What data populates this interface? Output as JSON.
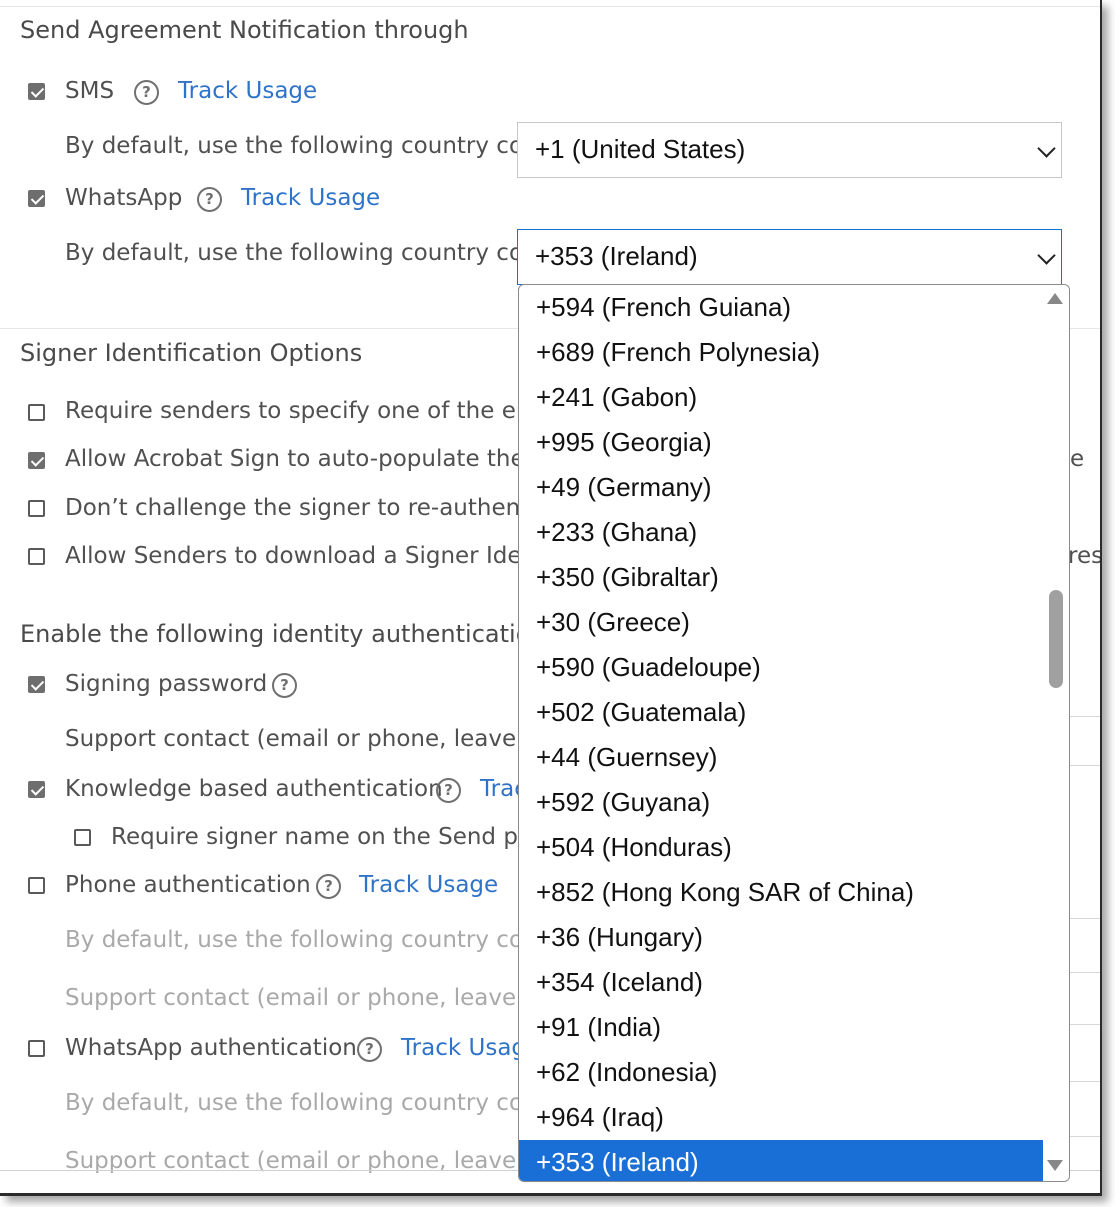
{
  "notification": {
    "heading": "Send Agreement Notification through",
    "sms_label": "SMS",
    "sms_track": "Track Usage",
    "sms_country_label": "By default, use the following country code:",
    "sms_country_value": "+1 (United States)",
    "whatsapp_label": "WhatsApp",
    "whatsapp_track": "Track Usage",
    "whatsapp_country_label": "By default, use the following country code:",
    "whatsapp_country_value": "+353 (Ireland)"
  },
  "signer": {
    "heading": "Signer Identification Options",
    "options": [
      {
        "left": "Require senders to specify one of the enab",
        "right": ""
      },
      {
        "left": "Allow Acrobat Sign to auto-populate the Si",
        "right": "e"
      },
      {
        "left": "Don’t challenge the signer to re-authenticat",
        "right": ""
      },
      {
        "left": "Allow Senders to download a Signer Identi",
        "right": "res"
      }
    ]
  },
  "auth": {
    "heading": "Enable the following identity authentication n",
    "signing_password": "Signing password",
    "support_contact": "Support contact (email or phone, leave it b",
    "kba": "Knowledge based authentication",
    "kba_track": "Trac",
    "require_signer_name": "Require signer name on the Send page",
    "phone_auth": "Phone authentication",
    "phone_track": "Track Usage",
    "phone_country_label": "By default, use the following country code:",
    "phone_support_contact": "Support contact (email or phone, leave it b",
    "whatsapp_auth": "WhatsApp authentication",
    "whatsapp_track": "Track Usage",
    "whatsapp_country_label": "By default, use the following country code:",
    "whatsapp_support_contact": "Support contact (email or phone, leave it b"
  },
  "dropdown": {
    "options": [
      "+594 (French Guiana)",
      "+689 (French Polynesia)",
      "+241 (Gabon)",
      "+995 (Georgia)",
      "+49 (Germany)",
      "+233 (Ghana)",
      "+350 (Gibraltar)",
      "+30 (Greece)",
      "+590 (Guadeloupe)",
      "+502 (Guatemala)",
      "+44 (Guernsey)",
      "+592 (Guyana)",
      "+504 (Honduras)",
      "+852 (Hong Kong SAR of China)",
      "+36 (Hungary)",
      "+354 (Iceland)",
      "+91 (India)",
      "+62 (Indonesia)",
      "+964 (Iraq)",
      "+353 (Ireland)"
    ],
    "selected": "+353 (Ireland)"
  },
  "colors": {
    "link": "#2f73c9",
    "selection": "#1a6fd6",
    "checkbox_checked": "#6e6e6e"
  }
}
